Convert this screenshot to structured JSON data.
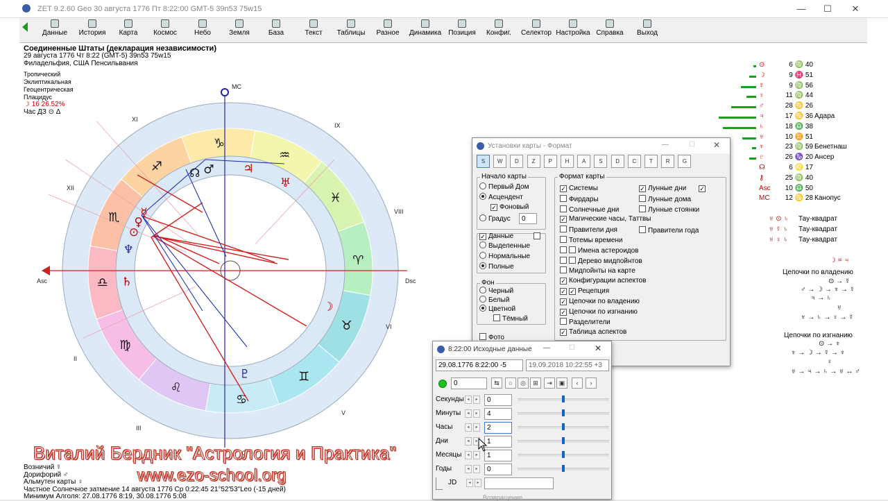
{
  "window": {
    "title": "ZET 9.2.60 Geo   30 августа 1776  Пт    8:22:00 GMT-5 39n53  75w15"
  },
  "toolbar": [
    "Данные",
    "История",
    "Карта",
    "Космос",
    "Небо",
    "Земля",
    "База",
    "Текст",
    "Таблицы",
    "Разное",
    "Динамика",
    "Позиция",
    "Конфиг.",
    "Селектор",
    "Настройка",
    "Справка",
    "Выход"
  ],
  "header": {
    "title": "Соединенные Штаты (декларация независимости)",
    "date_line": "29 августа 1776  Чт    8:22 (GMT-5)  39n53  75w15",
    "place": "Филадельфия, США Пенсильвания",
    "settings": [
      "Тропический",
      "Эклиптикальная",
      "Геоцентрическая",
      "Плацидус"
    ],
    "moon_line": "☽  16 26.52%",
    "hour_line": "Час ДЗ  ⊙  Δ"
  },
  "chart_labels": {
    "mc": "MC",
    "ic": "IC",
    "asc": "Asc",
    "dsc": "Dsc",
    "houses": [
      "XI",
      "IX",
      "XII",
      "VIII",
      "VI",
      "II",
      "V",
      "III"
    ]
  },
  "planets_table": [
    {
      "glyph": "⊙",
      "deg": "6 ♍ 40",
      "name": ""
    },
    {
      "glyph": "☽",
      "deg": "9 ♓ 51",
      "name": ""
    },
    {
      "glyph": "☿",
      "deg": "9 ♍ 56",
      "name": ""
    },
    {
      "glyph": "♀",
      "deg": "11 ♍ 44",
      "name": ""
    },
    {
      "glyph": "♂",
      "deg": "28 ♋ 26",
      "name": ""
    },
    {
      "glyph": "♃",
      "deg": "17 ♋ 36",
      "name": "Адара"
    },
    {
      "glyph": "♄",
      "deg": "18 ♎ 38",
      "name": ""
    },
    {
      "glyph": "♅",
      "deg": "10 ♊ 51",
      "name": ""
    },
    {
      "glyph": "♆",
      "deg": "23 ♍ 59",
      "name": "Бенетнаш"
    },
    {
      "glyph": "♇",
      "deg": "26 ♑ 20",
      "name": "Ансер"
    },
    {
      "glyph": "☊",
      "deg": "6 ♌ 17",
      "name": ""
    },
    {
      "glyph": "⚷",
      "deg": "25 ♍ 40",
      "name": ""
    },
    {
      "glyph": "Asc",
      "deg": "10 ♎ 50",
      "name": ""
    },
    {
      "glyph": "MC",
      "deg": "12 ♋ 28",
      "name": "Канопус"
    }
  ],
  "configurations": [
    {
      "glyphs": "♅ ⊙ ♄",
      "name": "Тау-квадрат"
    },
    {
      "glyphs": "♅ ☿ ♄",
      "name": "Тау-квадрат"
    },
    {
      "glyphs": "♅ ♀ ♄",
      "name": "Тау-квадрат"
    }
  ],
  "reception": "☽ = ♃",
  "chains_rule_title": "Цепочки по владению",
  "chains_rule": [
    "⊙ → ☿",
    "♂ → ☽ → ♆ → ☿",
    "♃ → ♄",
    "♅",
    "♆ → ♄ → ♀ → ☿"
  ],
  "chains_exile_title": "Цепочки по изгнанию",
  "chains_exile": [
    "⊙ → ♆",
    "♆ → ☽ → ☿ → ♆",
    "♀",
    "♅ → ♃ → ♄ → ♅ ↔ ♂"
  ],
  "format_dialog": {
    "title": "Установки карты - Формат",
    "icons": [
      "S",
      "W",
      "D",
      "Z",
      "P",
      "H",
      "A",
      "S",
      "D",
      "C",
      "T",
      "R",
      "G"
    ],
    "start_group": "Начало карты",
    "start_opts": [
      {
        "label": "Первый Дом",
        "on": false
      },
      {
        "label": "Асцендент",
        "on": true
      }
    ],
    "bg_check": "Фоновый",
    "degree_label": "Градус",
    "degree_value": "0",
    "data_label": "Данные",
    "data_opts": [
      {
        "label": "Выделенные",
        "on": false
      },
      {
        "label": "Нормальные",
        "on": false
      },
      {
        "label": "Полные",
        "on": true
      }
    ],
    "bg_group": "Фон",
    "bg_opts": [
      {
        "label": "Черный",
        "on": false
      },
      {
        "label": "Белый",
        "on": false
      },
      {
        "label": "Цветной",
        "on": true
      }
    ],
    "dark_label": "Тёмный",
    "photo_label": "Фото",
    "format_group": "Формат карты",
    "format_left": [
      {
        "label": "Системы",
        "on": true
      },
      {
        "label": "Фирдары",
        "on": false
      },
      {
        "label": "Солнечные дни",
        "on": false
      },
      {
        "label": "Магические часы, Таттвы",
        "on": true
      },
      {
        "label": "Правители дня",
        "on": false
      },
      {
        "label": "Тотемы времени",
        "on": false
      },
      {
        "label": "Имена астероидов",
        "on": false
      },
      {
        "label": "Дерево мидпойнтов",
        "on": false
      },
      {
        "label": "Мидпойнты на карте",
        "on": false
      },
      {
        "label": "Конфигурации аспектов",
        "on": true
      },
      {
        "label": "Рецепция",
        "on": true
      },
      {
        "label": "Цепочки по владению",
        "on": true
      },
      {
        "label": "Цепочки по изгнанию",
        "on": true
      },
      {
        "label": "Разделители",
        "on": false
      },
      {
        "label": "Таблица аспектов",
        "on": true
      }
    ],
    "format_right": [
      {
        "label": "Лунные дни",
        "on": true
      },
      {
        "label": "Лунные дома",
        "on": false
      },
      {
        "label": "Лунные стоянки",
        "on": false
      },
      {
        "label": "Правители года",
        "on": false
      }
    ]
  },
  "data_dialog": {
    "title": "8:22:00 Исходные данные",
    "datetime": "29.08.1776  8:22:00  -5",
    "now": "19.09.2018  10:22:55  +3",
    "counter": "0",
    "rows": [
      {
        "label": "Секунды",
        "value": "0",
        "level": 0.5
      },
      {
        "label": "Минуты",
        "value": "4",
        "level": 0.5
      },
      {
        "label": "Часы",
        "value": "2",
        "level": 0.5
      },
      {
        "label": "Дни",
        "value": "1",
        "level": 0.5
      },
      {
        "label": "Месяцы",
        "value": "1",
        "level": 0.5
      },
      {
        "label": "Годы",
        "value": "0",
        "level": 0.5
      }
    ],
    "jd_label": "JD",
    "bottom_label": "Возвращение"
  },
  "footer": [
    "Возничий  ☿",
    "Дорифорий  ♂",
    "Альмутен карты  ♀",
    "Частное Солнечное затмение 14 августа 1776 Ср  0:22:45 21°52'53\"Leo (-15 дней)",
    "Минимум Алголя: 27.08.1776  8:19, 30.08.1776  5:08"
  ],
  "watermark": {
    "line1": "Виталий Бердник \"Астрология и Практика\"",
    "line2": "www.ezo-school.org"
  }
}
